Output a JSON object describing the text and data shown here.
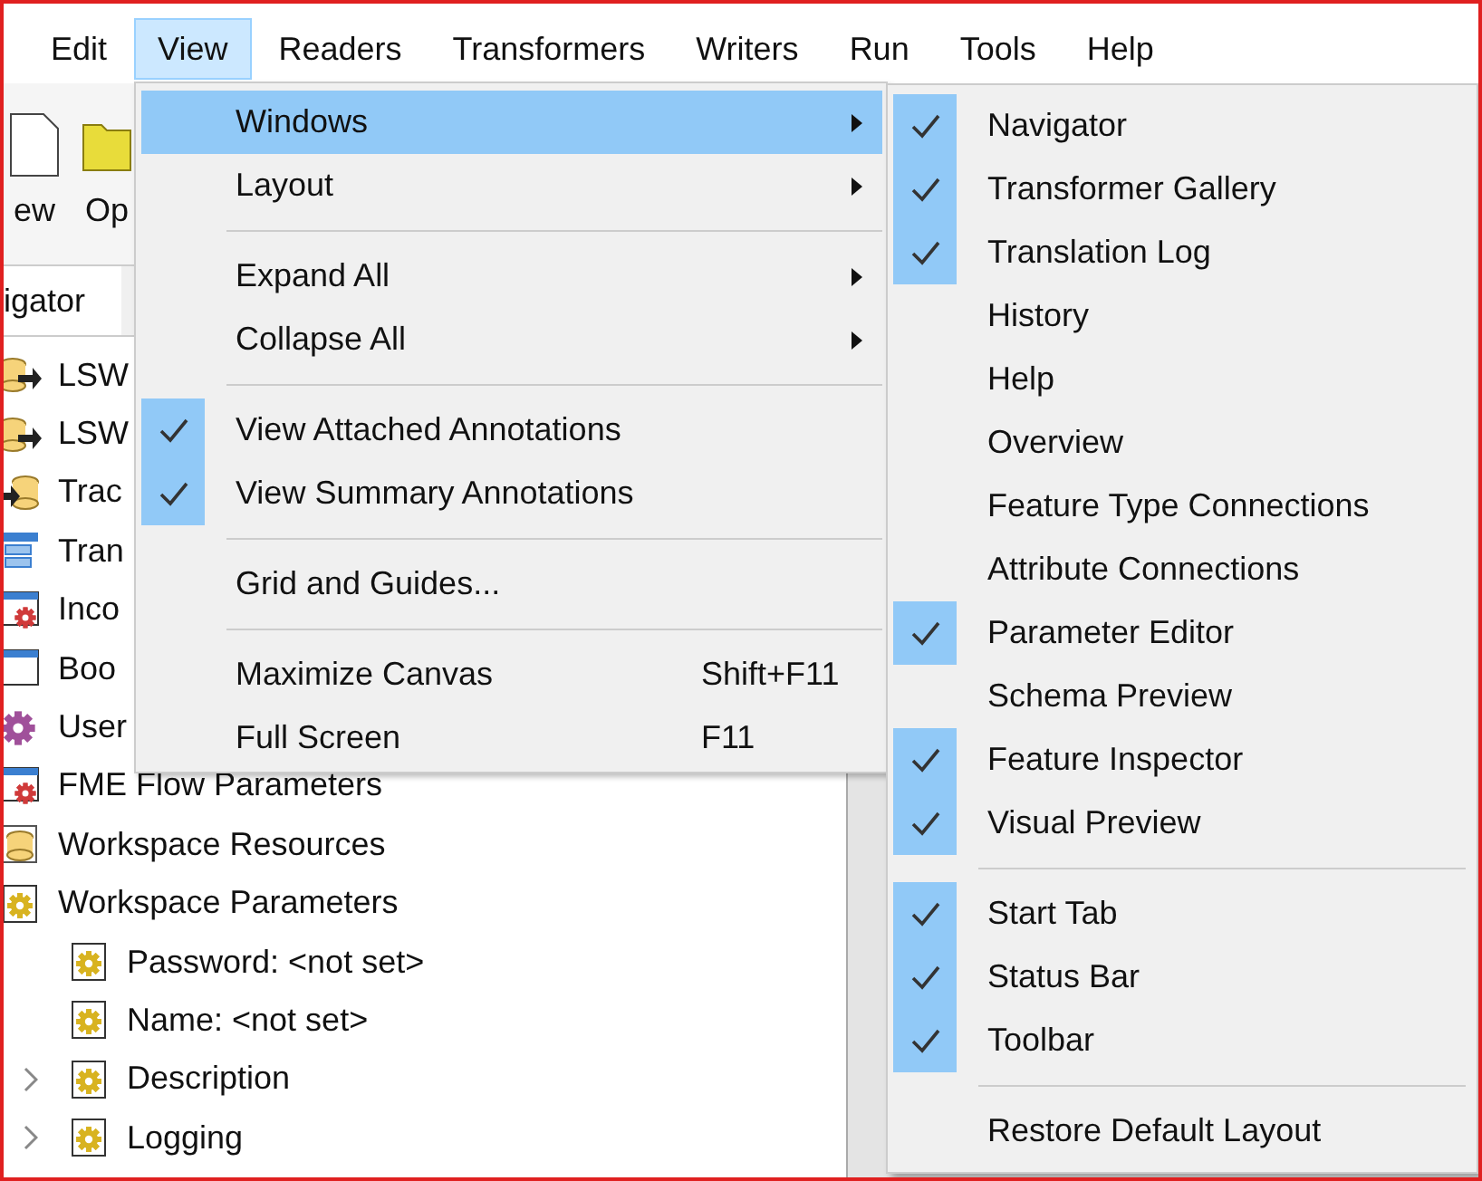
{
  "menubar": [
    {
      "label": "Edit",
      "selected": false
    },
    {
      "label": "View",
      "selected": true
    },
    {
      "label": "Readers",
      "selected": false
    },
    {
      "label": "Transformers",
      "selected": false
    },
    {
      "label": "Writers",
      "selected": false
    },
    {
      "label": "Run",
      "selected": false
    },
    {
      "label": "Tools",
      "selected": false
    },
    {
      "label": "Help",
      "selected": false
    }
  ],
  "toolbar": [
    {
      "label": "ew",
      "kind": "document"
    },
    {
      "label": "Op",
      "kind": "folder"
    }
  ],
  "navigator_tab": {
    "label": "igator"
  },
  "tree": [
    {
      "label": "LSW",
      "kind": "reader"
    },
    {
      "label": "LSW",
      "kind": "reader"
    },
    {
      "label": "Trac",
      "kind": "writer"
    },
    {
      "label": "Tran",
      "kind": "transformer"
    },
    {
      "label": "Inco",
      "kind": "window-gear"
    },
    {
      "label": "Boo",
      "kind": "window"
    },
    {
      "label": "User",
      "kind": "gear"
    },
    {
      "label": "FME Flow Parameters",
      "kind": "window-gear"
    },
    {
      "label": "Workspace Resources",
      "kind": "cylinder"
    },
    {
      "label": "Workspace Parameters",
      "kind": "doc-gear",
      "children": [
        {
          "label": "Password: <not set>",
          "collapsible": false
        },
        {
          "label": "Name: <not set>",
          "collapsible": false
        },
        {
          "label": "Description",
          "collapsible": true
        },
        {
          "label": "Logging",
          "collapsible": true
        }
      ]
    }
  ],
  "view_menu": [
    {
      "kind": "submenu",
      "label": "Windows",
      "selected": true
    },
    {
      "kind": "submenu",
      "label": "Layout",
      "selected": false
    },
    {
      "kind": "separator"
    },
    {
      "kind": "submenu",
      "label": "Expand All",
      "selected": false
    },
    {
      "kind": "submenu",
      "label": "Collapse All",
      "selected": false
    },
    {
      "kind": "separator"
    },
    {
      "kind": "check",
      "label": "View Attached Annotations",
      "checked": true
    },
    {
      "kind": "check",
      "label": "View Summary Annotations",
      "checked": true
    },
    {
      "kind": "separator"
    },
    {
      "kind": "action",
      "label": "Grid and Guides..."
    },
    {
      "kind": "separator"
    },
    {
      "kind": "action",
      "label": "Maximize Canvas",
      "shortcut": "Shift+F11"
    },
    {
      "kind": "action",
      "label": "Full Screen",
      "shortcut": "F11"
    }
  ],
  "windows_submenu": [
    {
      "kind": "check",
      "label": "Navigator",
      "checked": true
    },
    {
      "kind": "check",
      "label": "Transformer Gallery",
      "checked": true
    },
    {
      "kind": "check",
      "label": "Translation Log",
      "checked": true
    },
    {
      "kind": "check",
      "label": "History",
      "checked": false
    },
    {
      "kind": "check",
      "label": "Help",
      "checked": false
    },
    {
      "kind": "check",
      "label": "Overview",
      "checked": false
    },
    {
      "kind": "check",
      "label": "Feature Type Connections",
      "checked": false
    },
    {
      "kind": "check",
      "label": "Attribute Connections",
      "checked": false
    },
    {
      "kind": "check",
      "label": "Parameter Editor",
      "checked": true
    },
    {
      "kind": "check",
      "label": "Schema Preview",
      "checked": false
    },
    {
      "kind": "check",
      "label": "Feature Inspector",
      "checked": true
    },
    {
      "kind": "check",
      "label": "Visual Preview",
      "checked": true
    },
    {
      "kind": "separator"
    },
    {
      "kind": "check",
      "label": "Start Tab",
      "checked": true
    },
    {
      "kind": "check",
      "label": "Status Bar",
      "checked": true
    },
    {
      "kind": "check",
      "label": "Toolbar",
      "checked": true
    },
    {
      "kind": "separator"
    },
    {
      "kind": "action",
      "label": "Restore Default Layout"
    }
  ]
}
